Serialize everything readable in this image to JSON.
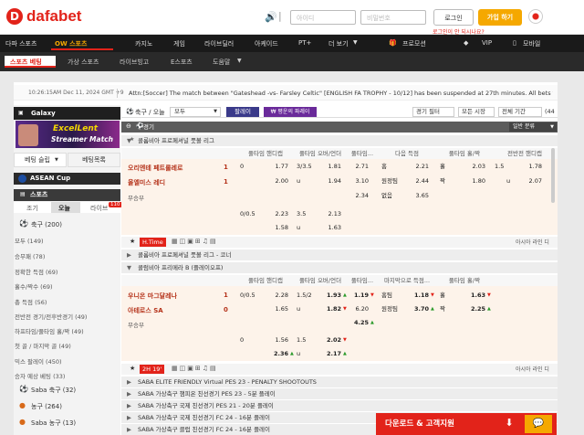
{
  "header": {
    "brand": "dafabet",
    "brand_mark": "D",
    "id_placeholder": "아이디",
    "pw_placeholder": "비밀번호",
    "login": "로그인",
    "join": "가입 하기",
    "forgot": "로그인이 안 되시나요?"
  },
  "nav": {
    "items": [
      "다파 스포츠",
      "OW 스포츠",
      "카지노",
      "게임",
      "라이브딜러",
      "아케이드",
      "PT+",
      "더 보기",
      "프로모션",
      "VIP",
      "모바일"
    ],
    "more_arrow": "▼"
  },
  "subnav": {
    "items": [
      "스포츠 베팅",
      "가상 스포츠",
      "라이브빙고",
      "E스포츠",
      "도움말"
    ]
  },
  "ticker": {
    "time": "10:26:15AM Dec 11, 2024 GMT +9",
    "message": "Attn:[Soccer] The match between \"Gateshead -vs- Farsley Celtic\" [ENGLISH FA TROPHY - 10/12] has been suspended at 27th minutes. All bets taken are"
  },
  "left": {
    "galaxy": "Galaxy",
    "promo_line1": "ExcelLent",
    "promo_line2": "Streamer Match",
    "tabs": [
      "베팅 슬립",
      "베팅목록"
    ],
    "asean": "ASEAN Cup",
    "sports_title": "스포츠",
    "time_tabs": [
      "조기",
      "오늘",
      "라이브"
    ],
    "live_count": "110",
    "soccer": "축구 (200)",
    "submenu": [
      "모두 (149)",
      "승무패 (78)",
      "정확한 득점 (69)",
      "홀수/짝수 (69)",
      "총 득점 (56)",
      "전반전 경기/전후반경기 (49)",
      "하프타임/풀타임 홀/짝 (49)",
      "첫 골 / 마지막 골 (49)",
      "믹스 팔레이 (450)",
      "승자 예상 베팅 (33)"
    ],
    "others": [
      "Saba 축구 (32)",
      "농구 (264)",
      "Saba 농구 (13)"
    ]
  },
  "filters": {
    "sport": "축구 / 오늘",
    "market": "모두",
    "parlay": "팔레이",
    "parlay2": "₩ 평운의 파레이",
    "filter1": "경기 필터",
    "filter2": "모든 시장",
    "filter3": "전체 기간",
    "page_count": "(44",
    "odds_type": "일반 분류"
  },
  "section": {
    "live_title": "경기"
  },
  "columns": {
    "a": "풀타임 핸디캡",
    "b": "풀타임 오버/언더",
    "c": "풀타임...",
    "d": "다음 득점",
    "e": "풀타임 홀/짝",
    "f": "전반전 핸디캡"
  },
  "match1": {
    "league": "콜롬비아 프로페셔널 풋볼 리그",
    "home": "오리엔테 페트롤레로",
    "away": "올엘미스 레디",
    "draw": "무승부",
    "home_score": "1",
    "away_score": "1",
    "row1": [
      "0",
      "1.77",
      "3/3.5",
      "1.81",
      "2.71",
      "홈",
      "2.21",
      "홀",
      "2.03",
      "1.5",
      "1.78"
    ],
    "row2": [
      "2.00",
      "u",
      "1.94",
      "3.10",
      "원정팀",
      "2.44",
      "짝",
      "1.80",
      "u",
      "2.07"
    ],
    "row3": [
      "2.34",
      "없음",
      "3.65"
    ],
    "row4": [
      "0/0.5",
      "2.23",
      "3.5",
      "2.13"
    ],
    "row5": [
      "1.58",
      "u",
      "1.63"
    ],
    "time": "H.Time",
    "more": "아시아 라인 디"
  },
  "leagues_mid": [
    "콜롬비아 프로페셔널 풋볼 리그 - 코너",
    "콜럼비아 프리메라 B (플레이오프)"
  ],
  "match2": {
    "cols": [
      "풀타임 핸디캡",
      "풀타임 오버/언더",
      "풀타임...",
      "마지막으로 득점...",
      "풀타임 홀/짝"
    ],
    "home": "우니온 마그달레나",
    "away": "아테로스 SA",
    "draw": "무승부",
    "home_score": "1",
    "away_score": "0",
    "row1": [
      "0/0.5",
      "2.28",
      "1.5/2",
      "1.93",
      "1.19",
      "홈팀",
      "1.18",
      "홀",
      "1.63"
    ],
    "row2": [
      "1.65",
      "u",
      "1.82",
      "6.20",
      "원정팀",
      "3.70",
      "짝",
      "2.25"
    ],
    "row3": [
      "4.25"
    ],
    "row4": [
      "0",
      "1.56",
      "1.5",
      "2.02"
    ],
    "row5": [
      "2.36",
      "u",
      "2.17"
    ],
    "time": "2H 19'",
    "more": "아시아 라인 디"
  },
  "leagues_bottom": [
    "SABA ELITE FRIENDLY Virtual PES 23 - PENALTY SHOOTOUTS",
    "SABA 가상축구 챔피온 친선경기 PES 23 - 5분 플레이",
    "SABA 가상축구 국제 친선경기 PES 21 - 20분 플레이",
    "SABA 가상축구 국제 친선경기 FC 24 - 16분 플레이",
    "SABA 가상축구 클럽 친선경기 FC 24 - 16분 플레이"
  ],
  "footer": {
    "download": "다운로드 & 고객지원"
  },
  "colors": {
    "brand": "#e2231a",
    "dark": "#1a1a1a",
    "odds_bg": "#fdf3ea",
    "team": "#b5331b"
  }
}
